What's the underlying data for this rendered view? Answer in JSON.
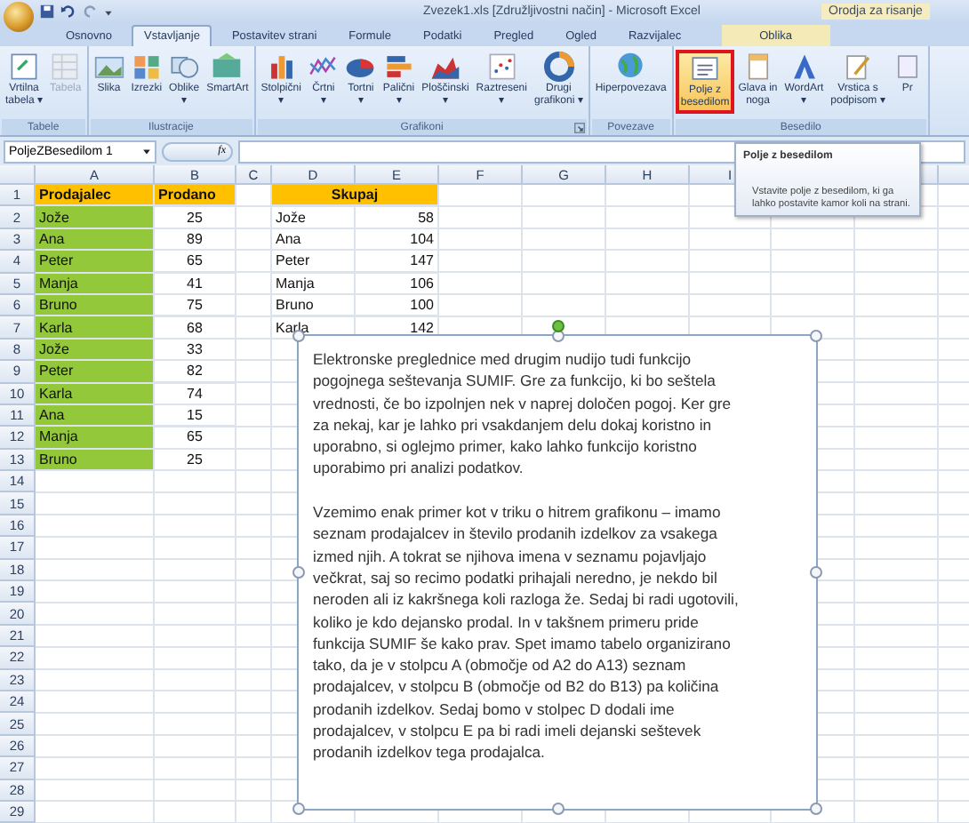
{
  "window": {
    "title": "Zvezek1.xls [Združljivostni način] - Microsoft Excel",
    "context_label": "Orodja za risanje"
  },
  "tabs": [
    {
      "label": "Osnovno",
      "selected": false,
      "contextual": false
    },
    {
      "label": "Vstavljanje",
      "selected": true,
      "contextual": false
    },
    {
      "label": "Postavitev strani",
      "selected": false,
      "contextual": false
    },
    {
      "label": "Formule",
      "selected": false,
      "contextual": false
    },
    {
      "label": "Podatki",
      "selected": false,
      "contextual": false
    },
    {
      "label": "Pregled",
      "selected": false,
      "contextual": false
    },
    {
      "label": "Ogled",
      "selected": false,
      "contextual": false
    },
    {
      "label": "Razvijalec",
      "selected": false,
      "contextual": false
    },
    {
      "label": "Oblika",
      "selected": false,
      "contextual": true
    }
  ],
  "ribbon": [
    {
      "label": "Tabele",
      "launcher": false,
      "buttons": [
        {
          "label": [
            "Vrtilna",
            "tabela ▾"
          ],
          "selected": false,
          "disabled": false
        },
        {
          "label": [
            "Tabela"
          ],
          "selected": false,
          "disabled": true
        }
      ]
    },
    {
      "label": "Ilustracije",
      "launcher": false,
      "buttons": [
        {
          "label": [
            "Slika"
          ],
          "selected": false,
          "disabled": false
        },
        {
          "label": [
            "Izrezki"
          ],
          "selected": false,
          "disabled": false
        },
        {
          "label": [
            "Oblike",
            "▾"
          ],
          "selected": false,
          "disabled": false
        },
        {
          "label": [
            "SmartArt"
          ],
          "selected": false,
          "disabled": false
        }
      ]
    },
    {
      "label": "Grafikoni",
      "launcher": true,
      "buttons": [
        {
          "label": [
            "Stolpični",
            "▾"
          ],
          "selected": false,
          "disabled": false
        },
        {
          "label": [
            "Črtni",
            "▾"
          ],
          "selected": false,
          "disabled": false
        },
        {
          "label": [
            "Tortni",
            "▾"
          ],
          "selected": false,
          "disabled": false
        },
        {
          "label": [
            "Palični",
            "▾"
          ],
          "selected": false,
          "disabled": false
        },
        {
          "label": [
            "Ploščinski",
            "▾"
          ],
          "selected": false,
          "disabled": false
        },
        {
          "label": [
            "Raztreseni",
            "▾"
          ],
          "selected": false,
          "disabled": false
        },
        {
          "label": [
            "Drugi",
            "grafikoni ▾"
          ],
          "selected": false,
          "disabled": false
        }
      ]
    },
    {
      "label": "Povezave",
      "launcher": false,
      "buttons": [
        {
          "label": [
            "Hiperpovezava"
          ],
          "selected": false,
          "disabled": false
        }
      ]
    },
    {
      "label": "Besedilo",
      "launcher": false,
      "buttons": [
        {
          "label": [
            "Polje z",
            "besedilom"
          ],
          "selected": true,
          "disabled": false
        },
        {
          "label": [
            "Glava in",
            "noga"
          ],
          "selected": false,
          "disabled": false
        },
        {
          "label": [
            "WordArt",
            "▾"
          ],
          "selected": false,
          "disabled": false
        },
        {
          "label": [
            "Vrstica s",
            "podpisom ▾"
          ],
          "selected": false,
          "disabled": false
        },
        {
          "label": [
            "Pr"
          ],
          "selected": false,
          "disabled": false
        }
      ]
    }
  ],
  "formula_bar": {
    "name_box": "PoljeZBesedilom 1",
    "fx": "fx"
  },
  "tooltip": {
    "title": "Polje z besedilom",
    "text": "Vstavite polje z besedilom, ki ga lahko postavite kamor koli na strani."
  },
  "sheet": {
    "columns": [
      "A",
      "B",
      "C",
      "D",
      "E",
      "F",
      "G",
      "H",
      "I"
    ],
    "row_numbers": [
      "1",
      "2",
      "3",
      "4",
      "5",
      "6",
      "7",
      "8",
      "9",
      "10",
      "11",
      "12",
      "13",
      "14",
      "15",
      "16",
      "17",
      "18",
      "19",
      "20",
      "21",
      "22",
      "23",
      "24",
      "25",
      "26",
      "27",
      "28",
      "29"
    ],
    "header": {
      "a": "Prodajalec",
      "b": "Prodano",
      "d_e": "Skupaj"
    },
    "rows": [
      {
        "a": "Jože",
        "b": "25",
        "d": "Jože",
        "e": "58"
      },
      {
        "a": "Ana",
        "b": "89",
        "d": "Ana",
        "e": "104"
      },
      {
        "a": "Peter",
        "b": "65",
        "d": "Peter",
        "e": "147"
      },
      {
        "a": "Manja",
        "b": "41",
        "d": "Manja",
        "e": "106"
      },
      {
        "a": "Bruno",
        "b": "75",
        "d": "Bruno",
        "e": "100"
      },
      {
        "a": "Karla",
        "b": "68",
        "d": "Karla",
        "e": "142"
      },
      {
        "a": "Jože",
        "b": "33"
      },
      {
        "a": "Peter",
        "b": "82"
      },
      {
        "a": "Karla",
        "b": "74"
      },
      {
        "a": "Ana",
        "b": "15"
      },
      {
        "a": "Manja",
        "b": "65"
      },
      {
        "a": "Bruno",
        "b": "25"
      }
    ]
  },
  "text_box": {
    "paragraphs": [
      [
        "Elektronske preglednice med drugim nudijo tudi funkcijo",
        "pogojnega seštevanja SUMIF. Gre za funkcijo, ki bo seštela",
        "vrednosti, če bo izpolnjen nek v naprej določen pogoj. Ker gre",
        "za nekaj, kar je lahko pri vsakdanjem delu dokaj koristno in",
        "uporabno, si oglejmo primer, kako lahko funkcijo koristno",
        "uporabimo pri analizi podatkov."
      ],
      [
        "Vzemimo enak primer kot v triku o hitrem grafikonu – imamo",
        "seznam prodajalcev in število prodanih izdelkov za vsakega",
        "izmed njih. A tokrat se njihova imena v seznamu pojavljajo",
        "večkrat, saj so recimo podatki prihajali neredno, je nekdo bil",
        "neroden ali iz kakršnega koli razloga že. Sedaj bi radi ugotovili,",
        "koliko je kdo dejansko prodal. In v takšnem primeru pride",
        "funkcija SUMIF še kako prav. Spet imamo tabelo organizirano",
        "tako, da je v stolpcu A (območje od A2 do A13) seznam",
        "prodajalcev, v stolpcu B (območje od B2 do B13) pa količina",
        "prodanih izdelkov. Sedaj bomo v stolpec D dodali ime",
        "prodajalcev, v stolpcu E pa bi radi imeli dejanski seštevek",
        "prodanih izdelkov tega prodajalca."
      ]
    ]
  }
}
